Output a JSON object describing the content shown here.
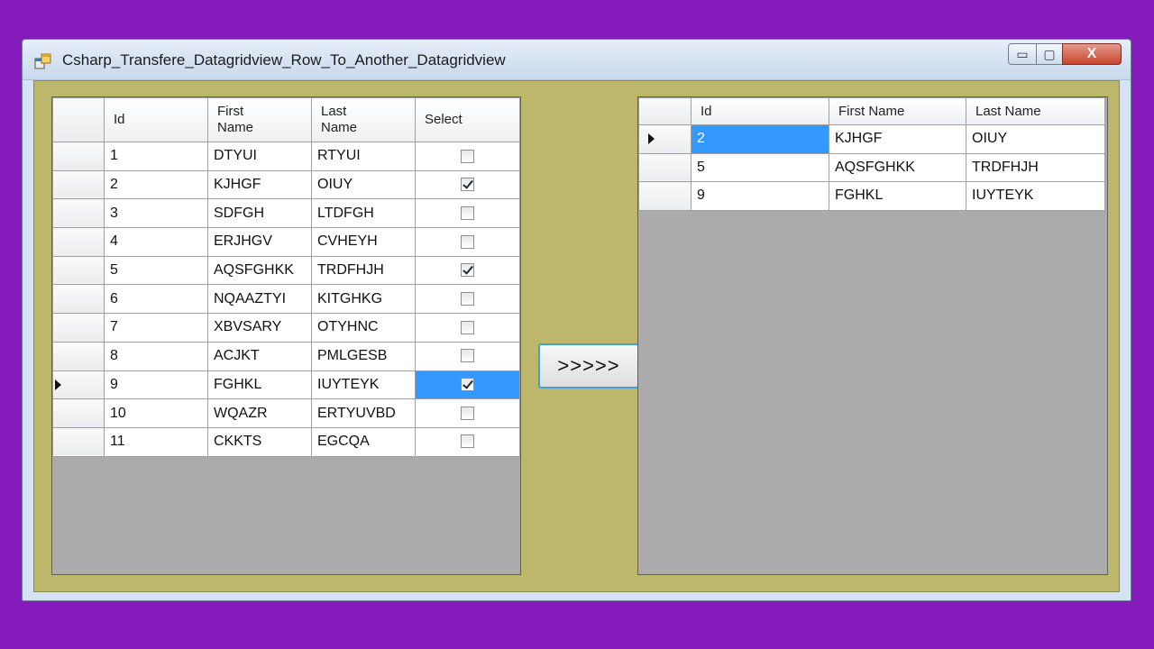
{
  "window": {
    "title": "Csharp_Transfere_Datagridview_Row_To_Another_Datagridview",
    "minimize_icon": "minimize-icon",
    "maximize_icon": "maximize-icon",
    "close_icon": "close-icon",
    "close_glyph": "X",
    "minimize_glyph": "▭",
    "maximize_glyph": "▢"
  },
  "left_grid": {
    "columns": [
      "Id",
      "First\nName",
      "Last\nName",
      "Select"
    ],
    "rows": [
      {
        "id": "1",
        "first": "DTYUI",
        "last": "RTYUI",
        "selected": false
      },
      {
        "id": "2",
        "first": "KJHGF",
        "last": "OIUY",
        "selected": true
      },
      {
        "id": "3",
        "first": "SDFGH",
        "last": "LTDFGH",
        "selected": false
      },
      {
        "id": "4",
        "first": "ERJHGV",
        "last": "CVHEYH",
        "selected": false
      },
      {
        "id": "5",
        "first": "AQSFGHKK",
        "last": "TRDFHJH",
        "selected": true
      },
      {
        "id": "6",
        "first": "NQAAZTYI",
        "last": "KITGHKG",
        "selected": false
      },
      {
        "id": "7",
        "first": "XBVSARY",
        "last": "OTYHNC",
        "selected": false
      },
      {
        "id": "8",
        "first": "ACJKT",
        "last": "PMLGESB",
        "selected": false
      },
      {
        "id": "9",
        "first": "FGHKL",
        "last": "IUYTEYK",
        "selected": true
      },
      {
        "id": "10",
        "first": "WQAZR",
        "last": "ERTYUVBD",
        "selected": false
      },
      {
        "id": "11",
        "first": "CKKTS",
        "last": "EGCQA",
        "selected": false
      }
    ],
    "current_row": 8
  },
  "button": {
    "label": ">>>>>"
  },
  "right_grid": {
    "columns": [
      "Id",
      "First Name",
      "Last Name"
    ],
    "rows": [
      {
        "id": "2",
        "first": "KJHGF",
        "last": "OIUY"
      },
      {
        "id": "5",
        "first": "AQSFGHKK",
        "last": "TRDFHJH"
      },
      {
        "id": "9",
        "first": "FGHKL",
        "last": "IUYTEYK"
      }
    ],
    "current_row": 0
  },
  "colors": {
    "background": "#851abb",
    "form_back": "#bdb76b",
    "grid_back": "#ababab",
    "selection": "#3399ff"
  }
}
